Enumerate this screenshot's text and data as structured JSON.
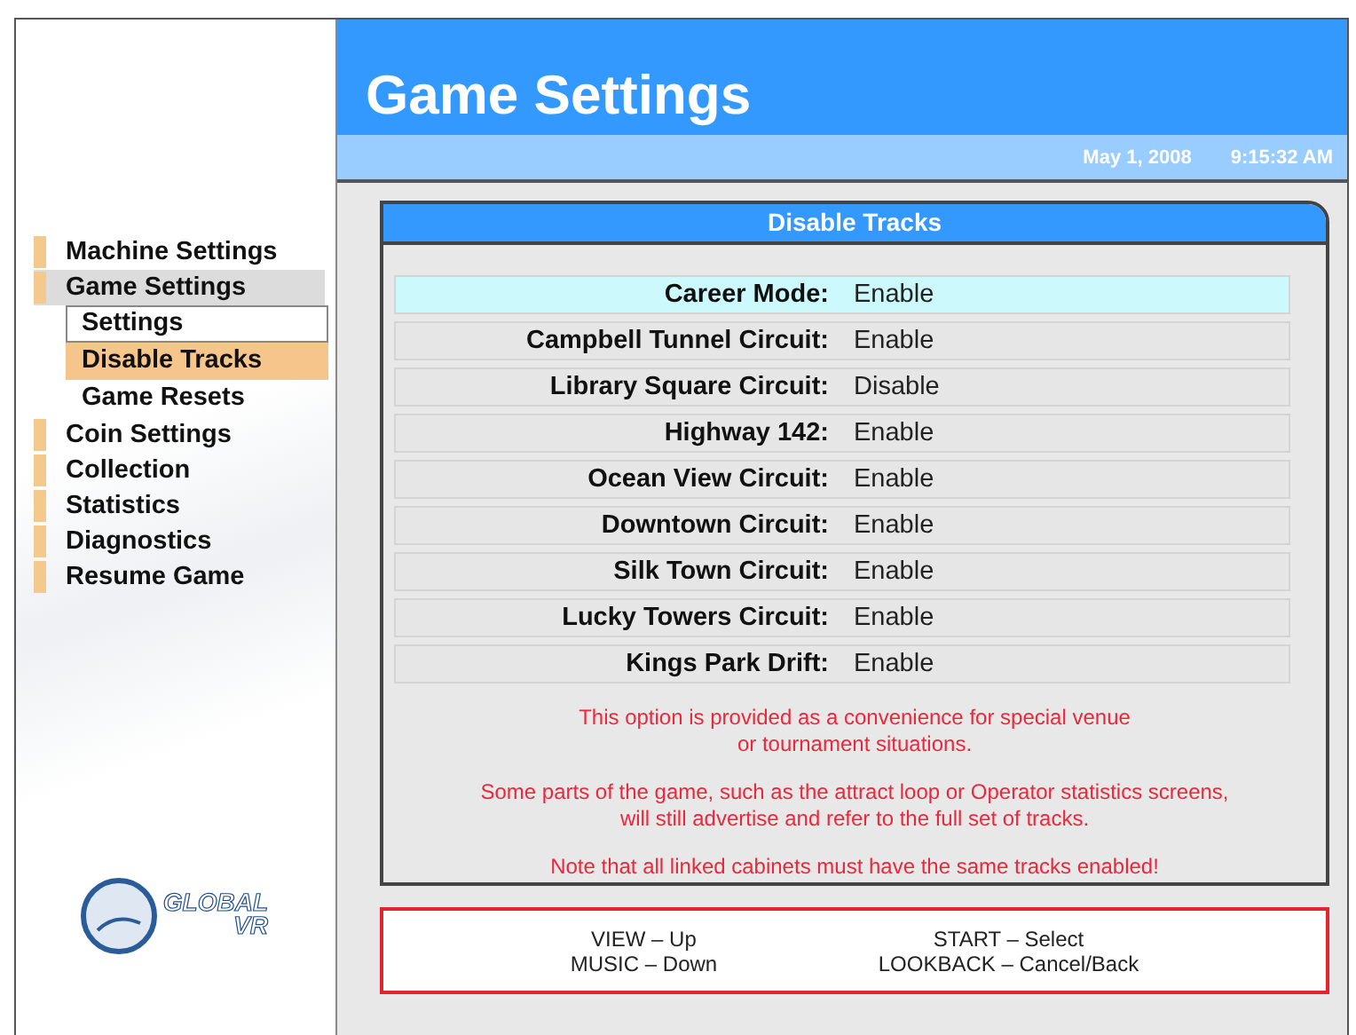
{
  "header": {
    "title": "Game Settings",
    "date": "May 1, 2008",
    "time": "9:15:32 AM"
  },
  "sidebar": {
    "items": [
      {
        "label": "Machine Settings",
        "selected": false
      },
      {
        "label": "Game Settings",
        "selected": true,
        "children": [
          {
            "label": "Settings",
            "selected": false,
            "outlined": true
          },
          {
            "label": "Disable Tracks",
            "selected": true,
            "outlined": false
          },
          {
            "label": "Game Resets",
            "selected": false,
            "outlined": false
          }
        ]
      },
      {
        "label": "Coin Settings",
        "selected": false
      },
      {
        "label": "Collection",
        "selected": false
      },
      {
        "label": "Statistics",
        "selected": false
      },
      {
        "label": "Diagnostics",
        "selected": false
      },
      {
        "label": "Resume Game",
        "selected": false
      }
    ],
    "logo": {
      "line1": "GLOBAL",
      "line2": "VR"
    }
  },
  "panel": {
    "title": "Disable Tracks",
    "rows": [
      {
        "label": "Career Mode:",
        "value": "Enable",
        "selected": true
      },
      {
        "label": "Campbell Tunnel Circuit:",
        "value": "Enable",
        "selected": false
      },
      {
        "label": "Library Square Circuit:",
        "value": "Disable",
        "selected": false
      },
      {
        "label": "Highway 142:",
        "value": "Enable",
        "selected": false
      },
      {
        "label": "Ocean View Circuit:",
        "value": "Enable",
        "selected": false
      },
      {
        "label": "Downtown Circuit:",
        "value": "Enable",
        "selected": false
      },
      {
        "label": "Silk Town Circuit:",
        "value": "Enable",
        "selected": false
      },
      {
        "label": "Lucky Towers Circuit:",
        "value": "Enable",
        "selected": false
      },
      {
        "label": "Kings Park Drift:",
        "value": "Enable",
        "selected": false
      }
    ],
    "notes": [
      [
        "This option is provided as a convenience for special venue",
        "or tournament situations."
      ],
      [
        "Some parts of the game, such as the attract loop or Operator statistics screens,",
        "will still advertise and refer to the full set of tracks."
      ],
      [
        "Note that all linked cabinets must have the same tracks enabled!"
      ]
    ]
  },
  "controls": [
    [
      "VIEW – Up",
      "MUSIC – Down"
    ],
    [
      "START – Select",
      "LOOKBACK – Cancel/Back"
    ]
  ]
}
